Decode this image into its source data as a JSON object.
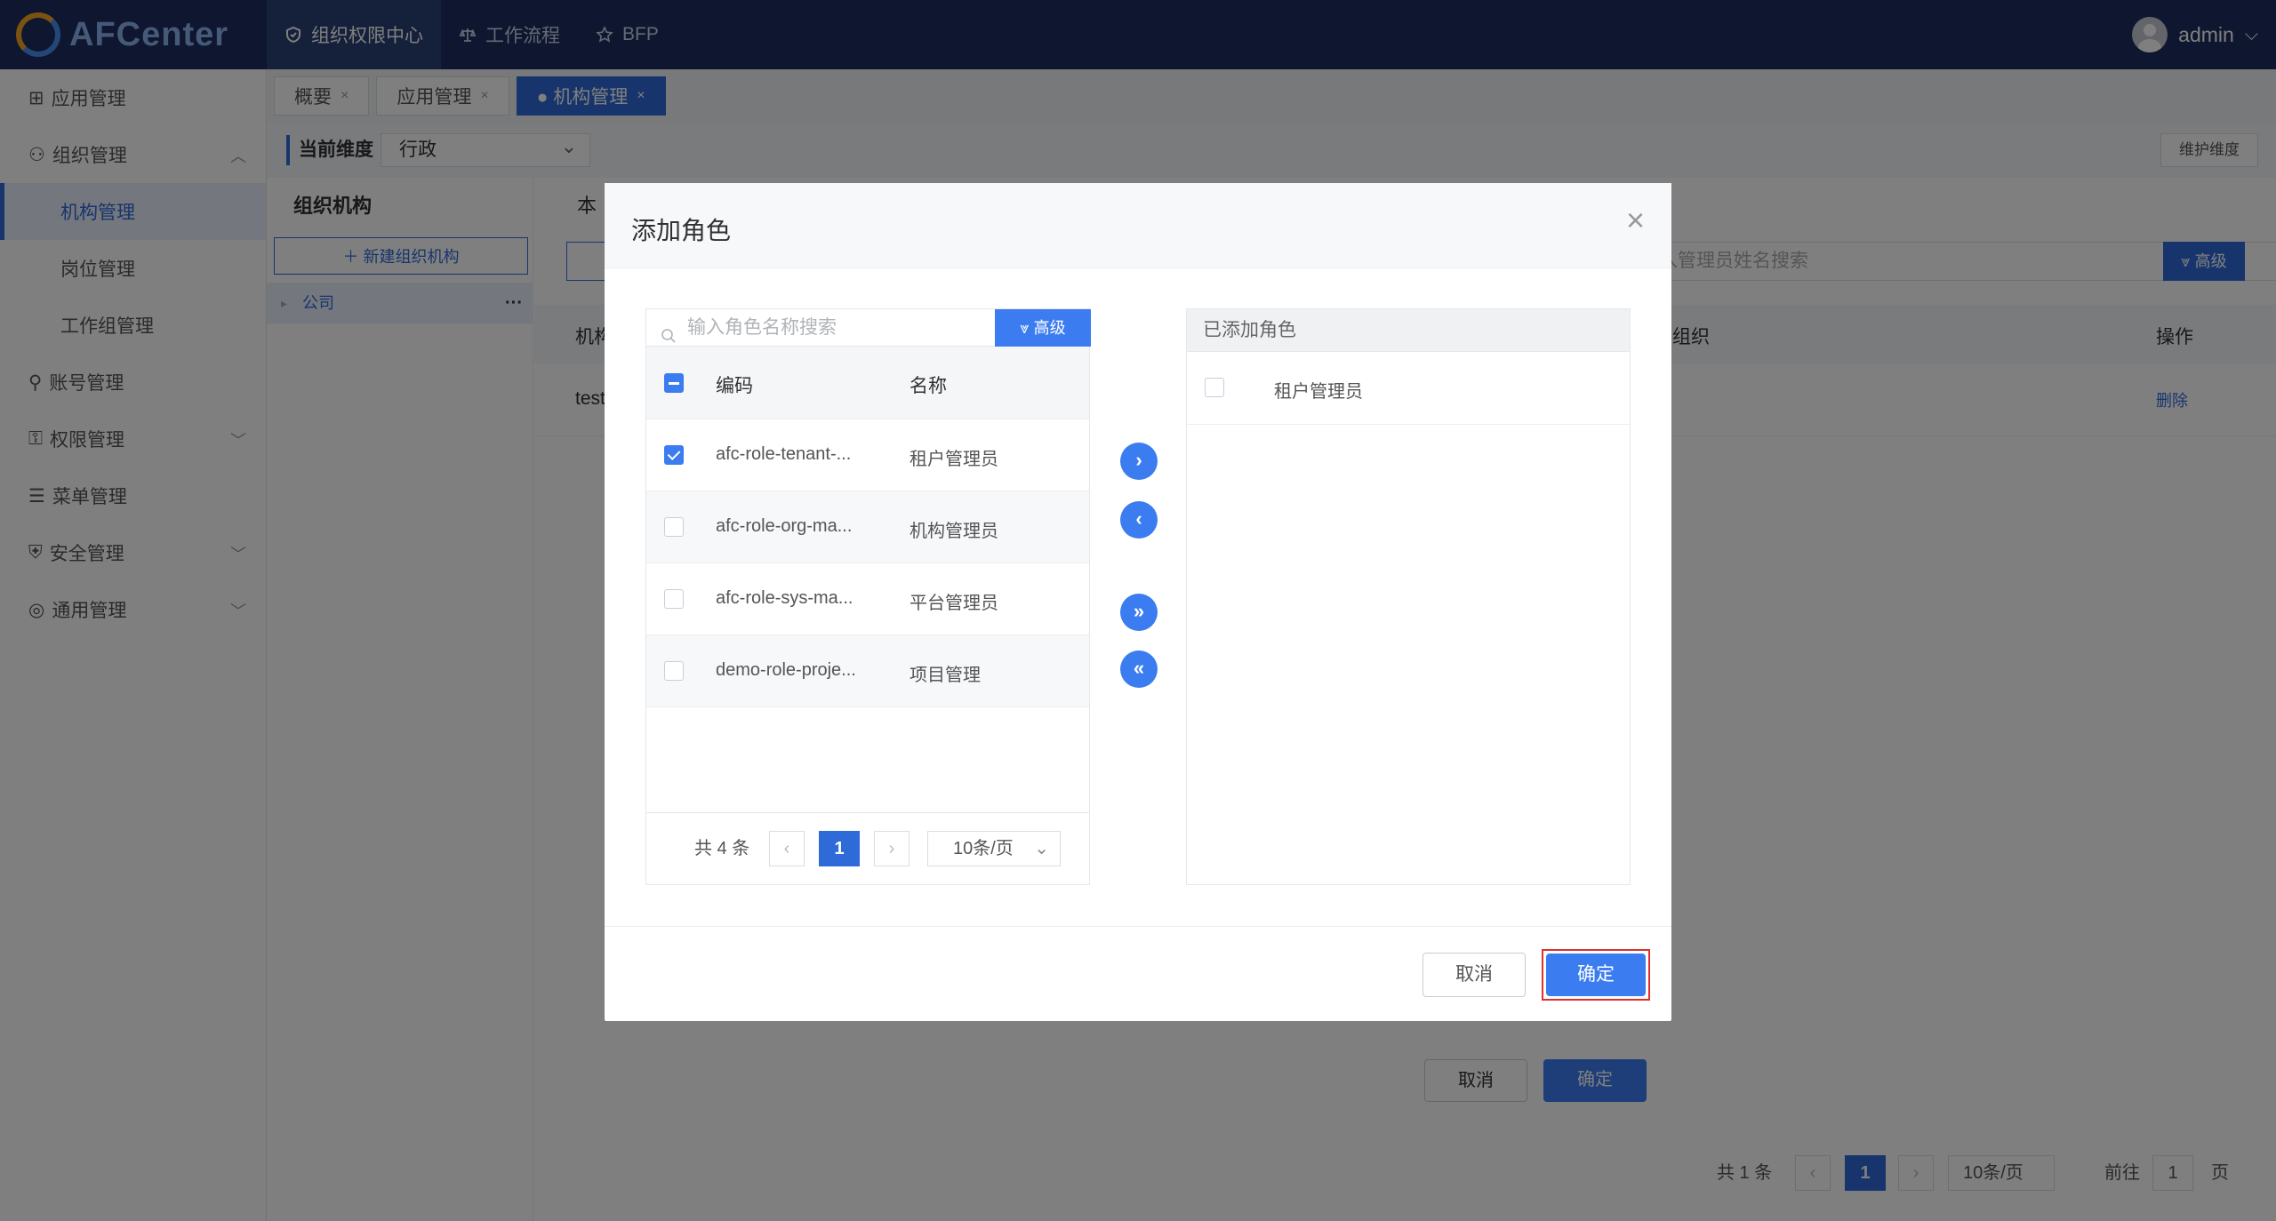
{
  "header": {
    "logo_text": "AFCenter",
    "nav": [
      {
        "label": "组织权限中心",
        "icon": "shield-icon"
      },
      {
        "label": "工作流程",
        "icon": "scale-icon"
      },
      {
        "label": "BFP",
        "icon": "star-icon"
      }
    ],
    "user": "admin"
  },
  "sidebar": {
    "items": [
      {
        "label": "应用管理"
      },
      {
        "label": "组织管理"
      },
      {
        "label": "机构管理"
      },
      {
        "label": "岗位管理"
      },
      {
        "label": "工作组管理"
      },
      {
        "label": "账号管理"
      },
      {
        "label": "权限管理"
      },
      {
        "label": "菜单管理"
      },
      {
        "label": "安全管理"
      },
      {
        "label": "通用管理"
      }
    ]
  },
  "tabs": [
    "概要",
    "应用管理",
    "● 机构管理"
  ],
  "dimension": {
    "label": "当前维度",
    "value": "行政",
    "maintain_btn": "维护维度"
  },
  "org_tree": {
    "title": "组织机构",
    "new_btn": "＋ 新建组织机构",
    "node": "公司"
  },
  "main": {
    "tab_label": "本",
    "search_placeholder": "入管理员姓名搜索",
    "adv_btn": "高级",
    "col_org": "机构",
    "col_org2": "组织",
    "col_ops": "操作",
    "row_name": "test",
    "row_action": "删除",
    "total": "共 1 条",
    "page": "1",
    "page_size": "10条/页",
    "goto_prefix": "前往",
    "goto_value": "1",
    "goto_suffix": "页"
  },
  "behind_dialog": {
    "cancel": "取消",
    "ok": "确定"
  },
  "modal": {
    "title": "添加角色",
    "search_placeholder": "输入角色名称搜索",
    "adv_btn": "高级",
    "col_code": "编码",
    "col_name": "名称",
    "rows": [
      {
        "code": "afc-role-tenant-...",
        "name": "租户管理员",
        "checked": true
      },
      {
        "code": "afc-role-org-ma...",
        "name": "机构管理员",
        "checked": false
      },
      {
        "code": "afc-role-sys-ma...",
        "name": "平台管理员",
        "checked": false
      },
      {
        "code": "demo-role-proje...",
        "name": "项目管理",
        "checked": false
      }
    ],
    "total": "共 4 条",
    "page": "1",
    "page_size": "10条/页",
    "right_header": "已添加角色",
    "added": [
      {
        "name": "租户管理员"
      }
    ],
    "cancel": "取消",
    "ok": "确定"
  },
  "colors": {
    "header_bg": "#1c2e5e",
    "primary": "#3b7cf0",
    "highlight": "#e0302c"
  }
}
